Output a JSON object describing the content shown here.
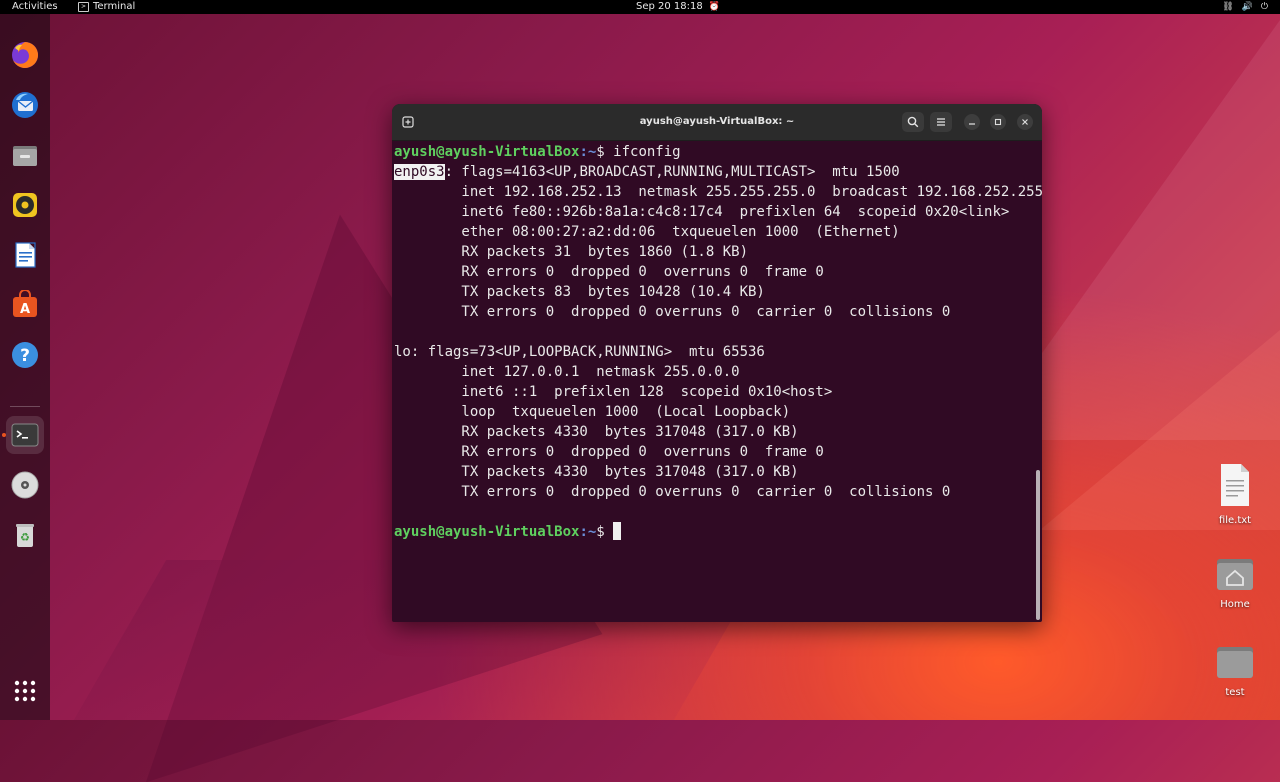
{
  "topbar": {
    "activities": "Activities",
    "app_name": "Terminal",
    "clock": "Sep 20  18:18"
  },
  "dock": {
    "apps": [
      {
        "name": "Firefox",
        "icon": "firefox-icon"
      },
      {
        "name": "Thunderbird Mail",
        "icon": "thunderbird-icon"
      },
      {
        "name": "Files",
        "icon": "files-icon"
      },
      {
        "name": "Rhythmbox",
        "icon": "rhythmbox-icon"
      },
      {
        "name": "LibreOffice Writer",
        "icon": "writer-icon"
      },
      {
        "name": "Ubuntu Software",
        "icon": "software-icon"
      },
      {
        "name": "Help",
        "icon": "help-icon"
      },
      {
        "name": "Terminal",
        "icon": "terminal-icon"
      },
      {
        "name": "VBox Guest Additions CD",
        "icon": "disc-icon"
      },
      {
        "name": "Trash",
        "icon": "trash-icon"
      }
    ],
    "show_apps_icon": "grid-icon"
  },
  "desktop": {
    "icons": [
      {
        "label": "file.txt",
        "icon": "text-file-icon"
      },
      {
        "label": "Home",
        "icon": "home-folder-icon"
      },
      {
        "label": "test",
        "icon": "folder-icon"
      }
    ]
  },
  "terminal": {
    "title": "ayush@ayush-VirtualBox: ~",
    "prompt_user": "ayush@ayush-VirtualBox",
    "prompt_path": ":~",
    "prompt_symbol": "$ ",
    "command": "ifconfig",
    "iface1_name": "enp0s3",
    "iface1_rest": ": flags=4163<UP,BROADCAST,RUNNING,MULTICAST>  mtu 1500",
    "iface1_lines": [
      "        inet 192.168.252.13  netmask 255.255.255.0  broadcast 192.168.252.255",
      "        inet6 fe80::926b:8a1a:c4c8:17c4  prefixlen 64  scopeid 0x20<link>",
      "        ether 08:00:27:a2:dd:06  txqueuelen 1000  (Ethernet)",
      "        RX packets 31  bytes 1860 (1.8 KB)",
      "        RX errors 0  dropped 0  overruns 0  frame 0",
      "        TX packets 83  bytes 10428 (10.4 KB)",
      "        TX errors 0  dropped 0 overruns 0  carrier 0  collisions 0"
    ],
    "iface2_header": "lo: flags=73<UP,LOOPBACK,RUNNING>  mtu 65536",
    "iface2_lines": [
      "        inet 127.0.0.1  netmask 255.0.0.0",
      "        inet6 ::1  prefixlen 128  scopeid 0x10<host>",
      "        loop  txqueuelen 1000  (Local Loopback)",
      "        RX packets 4330  bytes 317048 (317.0 KB)",
      "        RX errors 0  dropped 0  overruns 0  frame 0",
      "        TX packets 4330  bytes 317048 (317.0 KB)",
      "        TX errors 0  dropped 0 overruns 0  carrier 0  collisions 0"
    ]
  }
}
